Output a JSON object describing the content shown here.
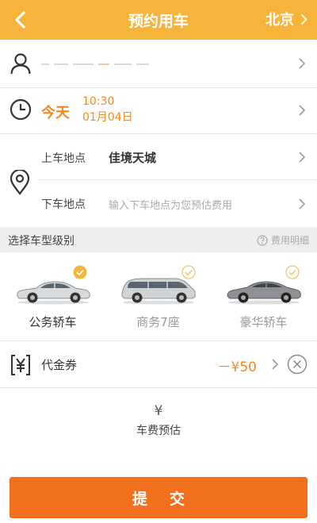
{
  "header": {
    "title": "预约用车",
    "city": "北京",
    "back_icon": "chevron-left-icon"
  },
  "passenger": {
    "masked_info": "(redacted)"
  },
  "time": {
    "day": "今天",
    "clock": "10:30",
    "date": "01月04日"
  },
  "pickup": {
    "label": "上车地点",
    "value": "佳境天城"
  },
  "dropoff": {
    "label": "下车地点",
    "placeholder": "输入下车地点为您预估费用"
  },
  "car_section": {
    "title": "选择车型级别",
    "fee_detail": "费用明细"
  },
  "cars": [
    {
      "label": "公务轿车",
      "selected": true
    },
    {
      "label": "商务7座",
      "selected": false
    },
    {
      "label": "豪华轿车",
      "selected": false
    }
  ],
  "coupon": {
    "label": "代金券",
    "amount": "－¥50"
  },
  "estimate": {
    "currency": "¥",
    "label": "车费预估"
  },
  "submit": {
    "label": "提交"
  },
  "colors": {
    "header": "#f7b43a",
    "accent": "#f08a1f",
    "submit": "#f26f1d"
  }
}
